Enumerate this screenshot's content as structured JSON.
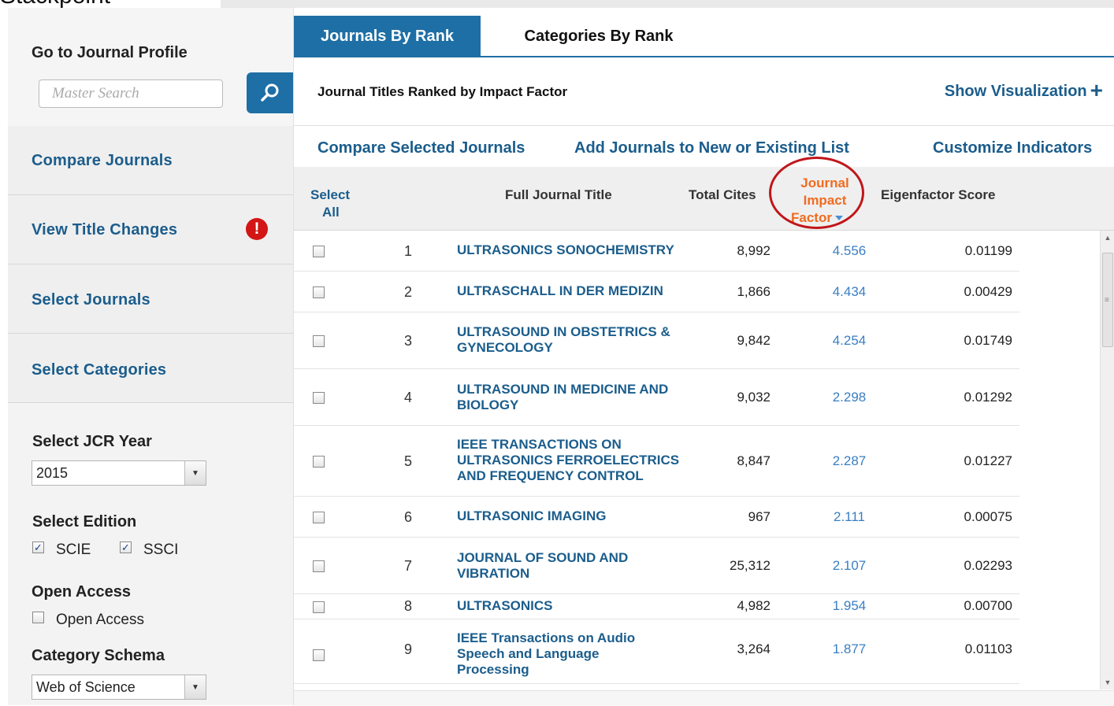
{
  "top_fragment": "Stackpoint",
  "sidebar": {
    "profile_title": "Go to Journal Profile",
    "search_placeholder": "Master Search",
    "links": [
      {
        "label": "Compare Journals"
      },
      {
        "label": "View Title Changes",
        "alert": "!"
      },
      {
        "label": "Select Journals"
      },
      {
        "label": "Select Categories"
      }
    ],
    "jcr_year": {
      "title": "Select JCR Year",
      "value": "2015"
    },
    "edition": {
      "title": "Select Edition",
      "options": [
        {
          "label": "SCIE",
          "checked": true
        },
        {
          "label": "SSCI",
          "checked": true
        }
      ]
    },
    "open_access": {
      "title": "Open Access",
      "label": "Open Access",
      "checked": false
    },
    "category_schema": {
      "title": "Category Schema",
      "value": "Web of Science"
    }
  },
  "tabs": [
    {
      "label": "Journals By Rank",
      "active": true
    },
    {
      "label": "Categories By Rank",
      "active": false
    }
  ],
  "subheader": {
    "caption": "Journal Titles Ranked by Impact Factor",
    "show_visualization": "Show Visualization",
    "plus": "+"
  },
  "actions": {
    "compare": "Compare Selected Journals",
    "add_list": "Add Journals to New or Existing List",
    "customize": "Customize Indicators"
  },
  "table": {
    "headers": {
      "select_line1": "Select",
      "select_line2": "All",
      "title": "Full Journal Title",
      "cites": "Total Cites",
      "jif_line1": "Journal",
      "jif_line2": "Impact",
      "jif_line3": "Factor",
      "eigen": "Eigenfactor Score"
    },
    "rows": [
      {
        "rank": "1",
        "title": "ULTRASONICS SONOCHEMISTRY",
        "cites": "8,992",
        "jif": "4.556",
        "eigen": "0.01199"
      },
      {
        "rank": "2",
        "title": "ULTRASCHALL IN DER MEDIZIN",
        "cites": "1,866",
        "jif": "4.434",
        "eigen": "0.00429"
      },
      {
        "rank": "3",
        "title": "ULTRASOUND IN OBSTETRICS & GYNECOLOGY",
        "cites": "9,842",
        "jif": "4.254",
        "eigen": "0.01749"
      },
      {
        "rank": "4",
        "title": "ULTRASOUND IN MEDICINE AND BIOLOGY",
        "cites": "9,032",
        "jif": "2.298",
        "eigen": "0.01292"
      },
      {
        "rank": "5",
        "title": "IEEE TRANSACTIONS ON ULTRASONICS FERROELECTRICS AND FREQUENCY CONTROL",
        "cites": "8,847",
        "jif": "2.287",
        "eigen": "0.01227"
      },
      {
        "rank": "6",
        "title": "ULTRASONIC IMAGING",
        "cites": "967",
        "jif": "2.111",
        "eigen": "0.00075"
      },
      {
        "rank": "7",
        "title": "JOURNAL OF SOUND AND VIBRATION",
        "cites": "25,312",
        "jif": "2.107",
        "eigen": "0.02293"
      },
      {
        "rank": "8",
        "title": "ULTRASONICS",
        "cites": "4,982",
        "jif": "1.954",
        "eigen": "0.00700"
      },
      {
        "rank": "9",
        "title": "IEEE Transactions on Audio Speech and Language Processing",
        "cites": "3,264",
        "jif": "1.877",
        "eigen": "0.01103"
      }
    ]
  },
  "colors": {
    "brand_blue": "#1e6fa5",
    "link_blue": "#1b5d8c",
    "sort_orange": "#f06b1f",
    "highlight_red": "#c0161a"
  }
}
